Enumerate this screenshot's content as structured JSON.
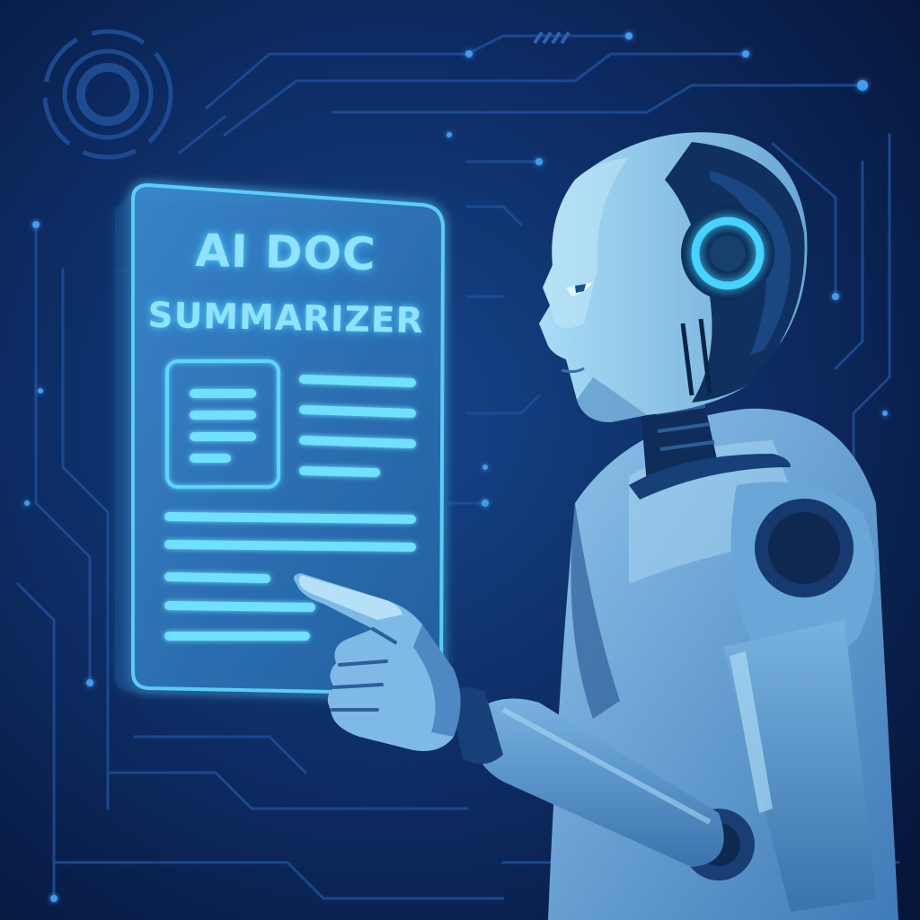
{
  "document_panel": {
    "title_line_1": "AI DOC",
    "title_line_2": "SUMMARIZER"
  },
  "colors": {
    "background_center": "#123a7a",
    "background_edge": "#06163a",
    "circuit": "#1e4f9a",
    "circuit_glow": "#3fa9ff",
    "panel_glow": "#4cc8ff",
    "panel_fill": "#2c6fb8",
    "robot_light": "#9dd2f0",
    "robot_mid": "#4f8fc6",
    "robot_dark": "#10315f",
    "ear_light": "#45d3ff"
  }
}
